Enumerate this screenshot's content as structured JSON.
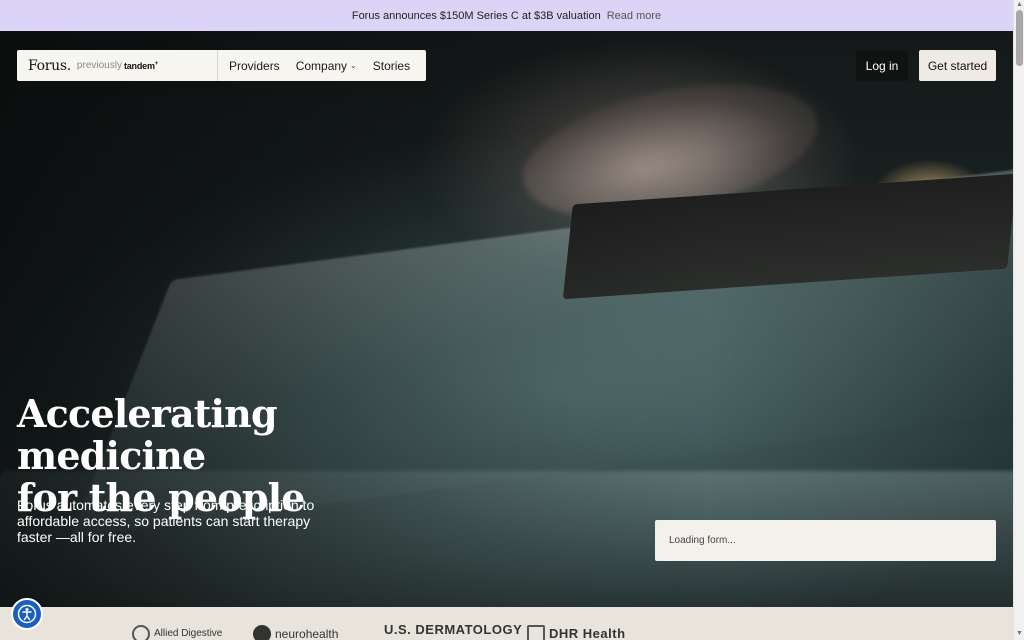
{
  "announcement": {
    "text": "Forus announces $150M Series C at $3B valuation",
    "link": "Read more",
    "background": "#dcd4f7"
  },
  "nav": {
    "logo": "Forus.",
    "previously": "previously",
    "previous_brand": "tandem",
    "previous_brand_mark": "+",
    "links": [
      {
        "label": "Providers",
        "has_dropdown": false
      },
      {
        "label": "Company",
        "has_dropdown": true
      },
      {
        "label": "Stories",
        "has_dropdown": false
      }
    ],
    "login": "Log in",
    "cta": "Get started"
  },
  "hero": {
    "headline_line1": "Accelerating medicine",
    "headline_line2": "for the people",
    "subcopy": "Forus automates every step from prescription to affordable access, so patients can start therapy faster —all for free.",
    "form_status": "Loading form..."
  },
  "partner_logos": [
    {
      "name": "Allied Digestive",
      "icon": "allied-logo-icon"
    },
    {
      "name": "neurohealth",
      "icon": "neurohealth-logo-icon"
    },
    {
      "name": "U.S. DERMATOLOGY",
      "icon": "usderm-logo-icon"
    },
    {
      "name": "DHR Health",
      "icon": "dhr-logo-icon"
    }
  ],
  "accessibility_button": {
    "icon": "accessibility-icon",
    "color": "#1a5fc0"
  },
  "colors": {
    "accent_dark": "#111313",
    "cta_bg": "#efebe4"
  }
}
